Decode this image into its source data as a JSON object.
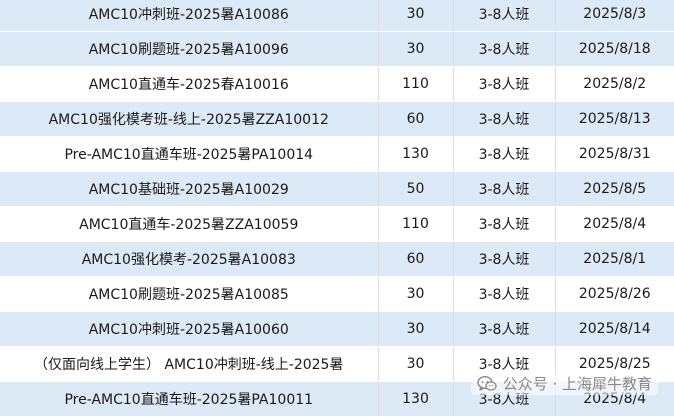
{
  "rows": [
    {
      "name": "AMC10冲刺班-2025暑A10086",
      "num": "30",
      "size": "3-8人班",
      "date": "2025/8/3"
    },
    {
      "name": "AMC10刷题班-2025暑A10096",
      "num": "30",
      "size": "3-8人班",
      "date": "2025/8/18"
    },
    {
      "name": "AMC10直通车-2025春A10016",
      "num": "110",
      "size": "3-8人班",
      "date": "2025/8/2"
    },
    {
      "name": "AMC10强化模考班-线上-2025暑ZZA10012",
      "num": "60",
      "size": "3-8人班",
      "date": "2025/8/13"
    },
    {
      "name": "Pre-AMC10直通车班-2025暑PA10014",
      "num": "130",
      "size": "3-8人班",
      "date": "2025/8/31"
    },
    {
      "name": "AMC10基础班-2025暑A10029",
      "num": "50",
      "size": "3-8人班",
      "date": "2025/8/5"
    },
    {
      "name": "AMC10直通车-2025暑ZZA10059",
      "num": "110",
      "size": "3-8人班",
      "date": "2025/8/4"
    },
    {
      "name": "AMC10强化模考-2025暑A10083",
      "num": "60",
      "size": "3-8人班",
      "date": "2025/8/1"
    },
    {
      "name": "AMC10刷题班-2025暑A10085",
      "num": "30",
      "size": "3-8人班",
      "date": "2025/8/26"
    },
    {
      "name": "AMC10冲刺班-2025暑A10060",
      "num": "30",
      "size": "3-8人班",
      "date": "2025/8/14"
    },
    {
      "name": "（仅面向线上学生） AMC10冲刺班-线上-2025暑",
      "num": "30",
      "size": "3-8人班",
      "date": "2025/8/25"
    },
    {
      "name": "Pre-AMC10直通车班-2025暑PA10011",
      "num": "130",
      "size": "3-8人班",
      "date": "2025/8/4"
    }
  ],
  "watermark": {
    "text": "公众号 · 上海犀牛教育",
    "icon": "wechat-icon"
  },
  "colors": {
    "band_blue": "#dce9f6",
    "band_white": "#ffffff"
  }
}
